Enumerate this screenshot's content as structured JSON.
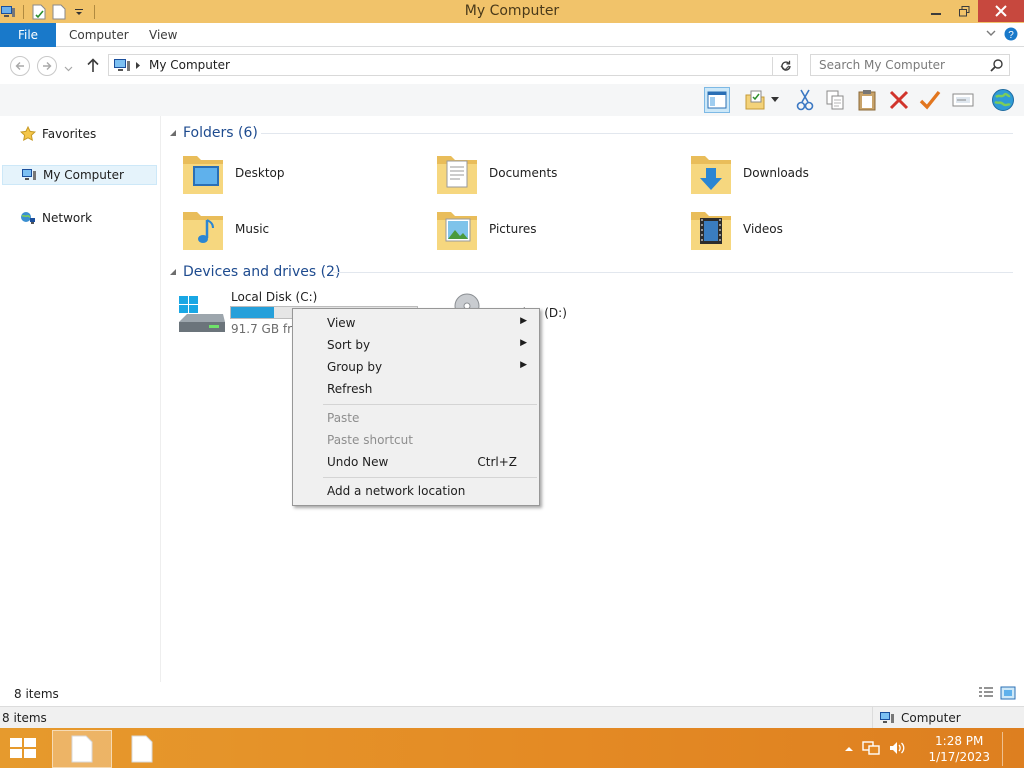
{
  "window": {
    "title": "My Computer"
  },
  "ribbon": {
    "tabs": [
      "File",
      "Computer",
      "View"
    ],
    "chevron_icon": "chevron-down-icon",
    "help_icon": "help-icon"
  },
  "address": {
    "path": "My Computer",
    "search_placeholder": "Search My Computer"
  },
  "toolbar": {
    "buttons": [
      "preview-pane-icon",
      "properties-icon",
      "cut-icon",
      "copy-icon",
      "paste-icon",
      "delete-icon",
      "checkmark-icon",
      "rename-icon",
      "globe-icon"
    ]
  },
  "navigation": {
    "items": [
      {
        "label": "Favorites",
        "icon": "star-icon"
      },
      {
        "label": "My Computer",
        "icon": "computer-icon"
      },
      {
        "label": "Network",
        "icon": "network-icon"
      }
    ]
  },
  "content": {
    "folders_header": "Folders (6)",
    "folders": [
      {
        "label": "Desktop"
      },
      {
        "label": "Documents"
      },
      {
        "label": "Downloads"
      },
      {
        "label": "Music"
      },
      {
        "label": "Pictures"
      },
      {
        "label": "Videos"
      }
    ],
    "drives_header": "Devices and drives (2)",
    "drives": [
      {
        "label": "Local Disk (C:)",
        "free": "91.7 GB free",
        "used_fraction": 0.23
      },
      {
        "label": "CD Drive (D:)"
      }
    ]
  },
  "context_menu": {
    "items": [
      {
        "label": "View",
        "submenu": true
      },
      {
        "label": "Sort by",
        "submenu": true
      },
      {
        "label": "Group by",
        "submenu": true
      },
      {
        "label": "Refresh"
      },
      {
        "label": "Paste",
        "disabled": true
      },
      {
        "label": "Paste shortcut",
        "disabled": true
      },
      {
        "label": "Undo New",
        "shortcut": "Ctrl+Z"
      },
      {
        "label": "Add a network location"
      }
    ]
  },
  "status": {
    "items_count": "8 items",
    "items_count_bottom": "8 items",
    "location": "Computer"
  },
  "taskbar": {
    "time": "1:28 PM",
    "date": "1/17/2023"
  },
  "colors": {
    "titlebar": "#f1c36a",
    "file_tab": "#1979ca",
    "close_button": "#c7483e",
    "taskbar": "#e48a24",
    "group_header": "#1e4b8f",
    "disk_fill": "#26a0da"
  }
}
